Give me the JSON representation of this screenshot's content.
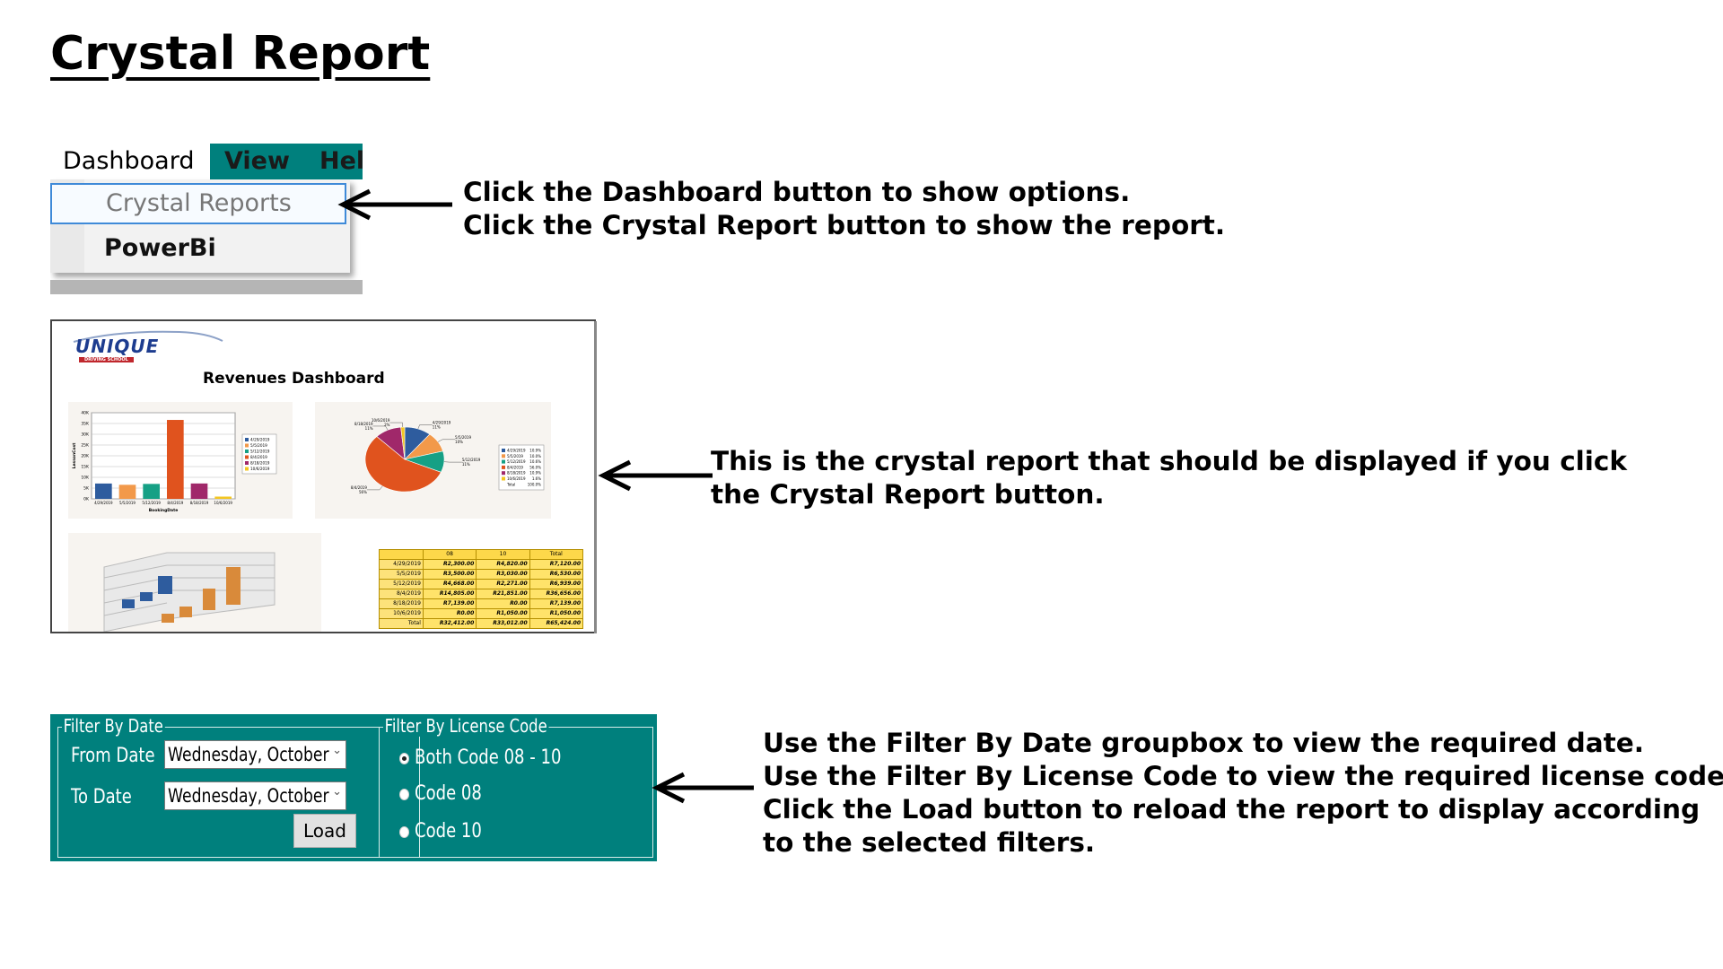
{
  "page_title": "Crystal Report",
  "menu": {
    "items": [
      "Dashboard",
      "View",
      "Hel"
    ],
    "dropdown": [
      "Crystal Reports",
      "PowerBi"
    ]
  },
  "notes": {
    "menu": [
      "Click the Dashboard button to show options.",
      "Click the Crystal Report button to show the report."
    ],
    "report": [
      "This is the crystal  report that should be displayed if you click",
      "the Crystal Report button."
    ],
    "filter": [
      "Use the Filter By Date groupbox to view the required date.",
      "Use the Filter By License Code to view the required license code.",
      "Click the Load button to reload the report to display according",
      "to the selected filters."
    ]
  },
  "report": {
    "logo_text": "UNIQUE",
    "logo_subtext": "DRIVING SCHOOL",
    "title": "Revenues Dashboard",
    "colors": [
      "#2e5c9e",
      "#f2994a",
      "#16a085",
      "#e0531e",
      "#a0286a",
      "#f3c623"
    ],
    "table": {
      "header": [
        "",
        "08",
        "10",
        "Total"
      ],
      "rows": [
        [
          "4/29/2019",
          "R2,300.00",
          "R4,820.00",
          "R7,120.00"
        ],
        [
          "5/5/2019",
          "R3,500.00",
          "R3,030.00",
          "R6,530.00"
        ],
        [
          "5/12/2019",
          "R4,668.00",
          "R2,271.00",
          "R6,939.00"
        ],
        [
          "8/4/2019",
          "R14,805.00",
          "R21,851.00",
          "R36,656.00"
        ],
        [
          "8/18/2019",
          "R7,139.00",
          "R0.00",
          "R7,139.00"
        ],
        [
          "10/6/2019",
          "R0.00",
          "R1,050.00",
          "R1,050.00"
        ],
        [
          "Total",
          "R32,412.00",
          "R33,012.00",
          "R65,424.00"
        ]
      ]
    }
  },
  "chart_data": [
    {
      "type": "bar",
      "xlabel": "BookingDate",
      "ylabel": "LessonCost",
      "categories": [
        "4/29/2019",
        "5/5/2019",
        "5/12/2019",
        "8/4/2019",
        "8/18/2019",
        "10/6/2019"
      ],
      "values": [
        7120,
        6530,
        6939,
        36656,
        7139,
        1050
      ],
      "ylim": [
        0,
        40000
      ],
      "yticks": [
        "0K",
        "5K",
        "10K",
        "15K",
        "20K",
        "25K",
        "30K",
        "35K",
        "40K"
      ],
      "legend": [
        "4/29/2019",
        "5/5/2019",
        "5/12/2019",
        "8/4/2019",
        "8/18/2019",
        "10/6/2019"
      ],
      "legend_position": "right"
    },
    {
      "type": "pie",
      "categories": [
        "4/29/2019",
        "5/5/2019",
        "5/12/2019",
        "8/4/2019",
        "8/18/2019",
        "10/6/2019"
      ],
      "values": [
        10.9,
        10.0,
        10.6,
        56.0,
        10.9,
        1.6
      ],
      "slice_labels": [
        "11%",
        "10%",
        "11%",
        "56%",
        "11%",
        "2%"
      ],
      "legend": [
        "4/29/2019",
        "5/5/2019",
        "5/12/2019",
        "8/4/2019",
        "8/18/2019",
        "10/6/2019",
        "Total"
      ],
      "legend_values": [
        "10.9%",
        "10.0%",
        "10.6%",
        "56.0%",
        "10.9%",
        "1.6%",
        "100.0%"
      ],
      "legend_position": "right"
    }
  ],
  "filter": {
    "date_group_title": "Filter By Date",
    "from_label": "From Date",
    "from_value": "Wednesday,   October",
    "to_label": "To Date",
    "to_value": "Wednesday,   October",
    "load_label": "Load",
    "license_group_title": "Filter By License Code",
    "license_options": [
      "Both Code 08 - 10",
      "Code 08",
      "Code 10"
    ],
    "selected_license": "Both Code 08 - 10"
  }
}
